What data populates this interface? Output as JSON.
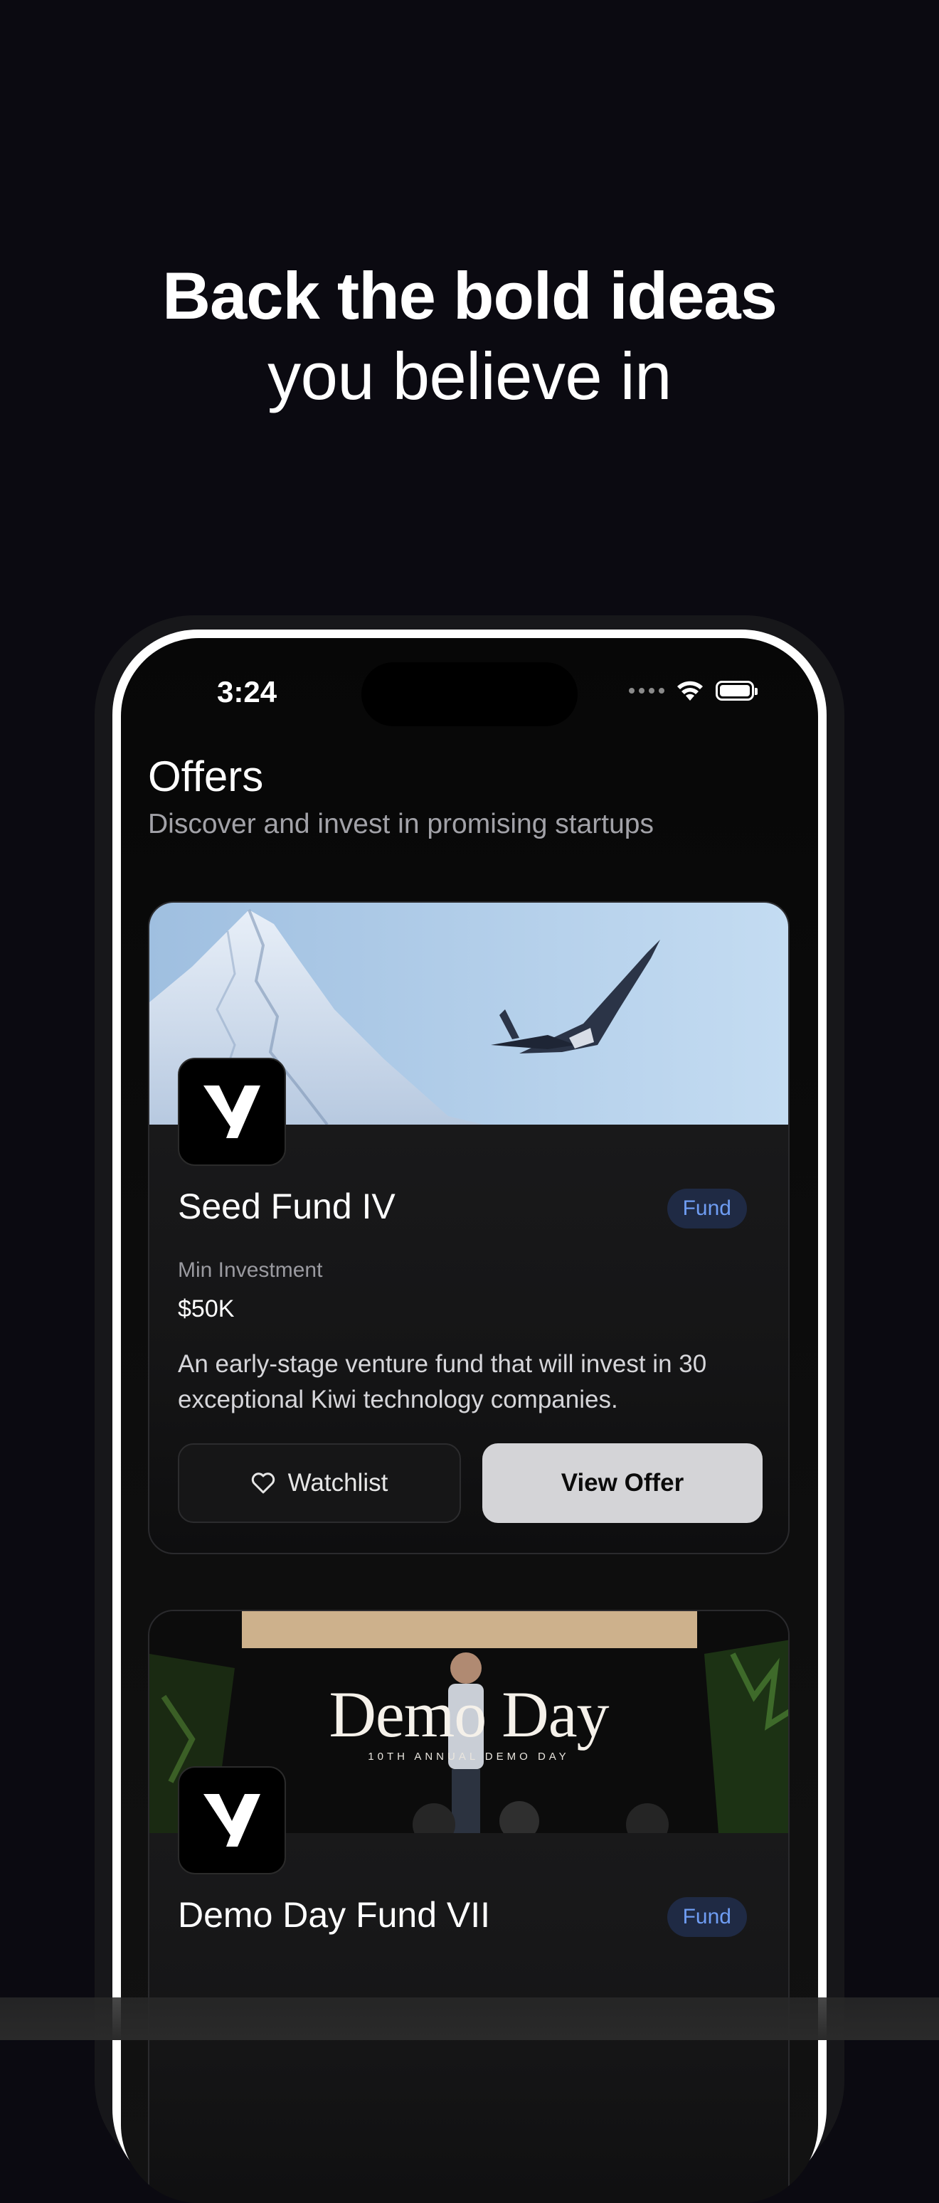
{
  "headline": {
    "line1": "Back the bold ideas",
    "line2": "you believe in"
  },
  "status_bar": {
    "time": "3:24"
  },
  "page": {
    "title": "Offers",
    "subtitle": "Discover and invest in promising startups"
  },
  "offers": [
    {
      "title": "Seed Fund IV",
      "badge": "Fund",
      "min_investment_label": "Min Investment",
      "min_investment_value": "$50K",
      "description": "An early-stage venture fund that will invest in 30 exceptional Kiwi technology companies.",
      "watchlist_label": "Watchlist",
      "view_label": "View Offer",
      "banner": "snowy-mountain-jet"
    },
    {
      "title": "Demo Day Fund VII",
      "badge": "Fund",
      "banner_title": "Demo Day",
      "banner_subtitle": "10TH ANNUAL DEMO DAY",
      "banner": "stage-speaker"
    }
  ],
  "colors": {
    "background": "#0b0a11",
    "badge_text": "#6f9df3",
    "badge_bg": "#1f2a44",
    "primary_button": "#d4d4d7"
  }
}
